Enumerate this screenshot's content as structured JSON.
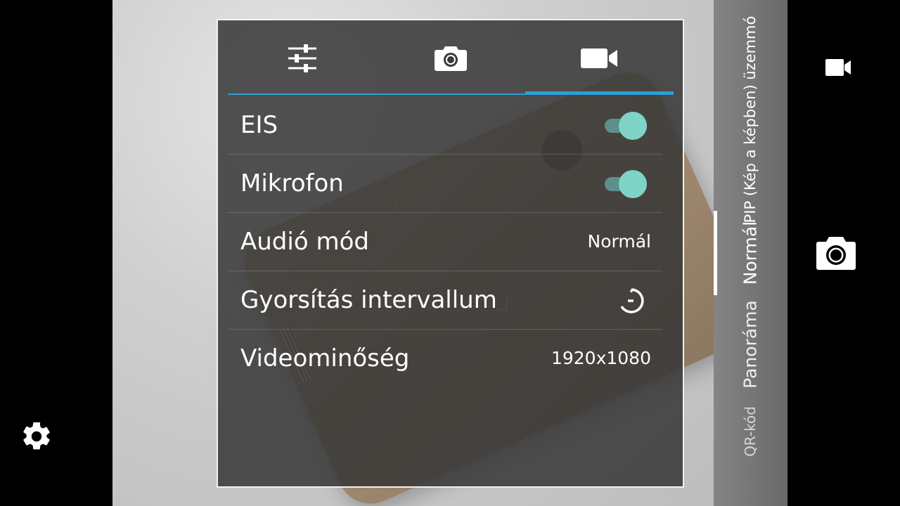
{
  "left_bar": {
    "settings_icon": "gear-icon"
  },
  "settings_panel": {
    "tabs": [
      {
        "icon": "sliders-icon",
        "active": false
      },
      {
        "icon": "camera-icon",
        "active": false
      },
      {
        "icon": "videocam-icon",
        "active": true
      }
    ],
    "accent_color": "#2a9fd6",
    "rows": [
      {
        "label": "EIS",
        "type": "toggle",
        "on": true
      },
      {
        "label": "Mikrofon",
        "type": "toggle",
        "on": true
      },
      {
        "label": "Audió mód",
        "type": "value",
        "value": "Normál"
      },
      {
        "label": "Gyorsítás intervallum",
        "type": "icon",
        "icon": "timer-off-icon"
      },
      {
        "label": "Videominőség",
        "type": "value",
        "value": "1920x1080"
      }
    ]
  },
  "mode_strip": {
    "modes": [
      "PIP (Kép a képben) üzemmó",
      "Normál",
      "Panoráma",
      "QR-kód"
    ],
    "selected": "Normál"
  },
  "right_bar": {
    "video_icon": "videocam-icon",
    "shutter_icon": "camera-icon"
  },
  "colors": {
    "toggle_on": "#7fd3c7",
    "panel_bg": "#373737"
  }
}
